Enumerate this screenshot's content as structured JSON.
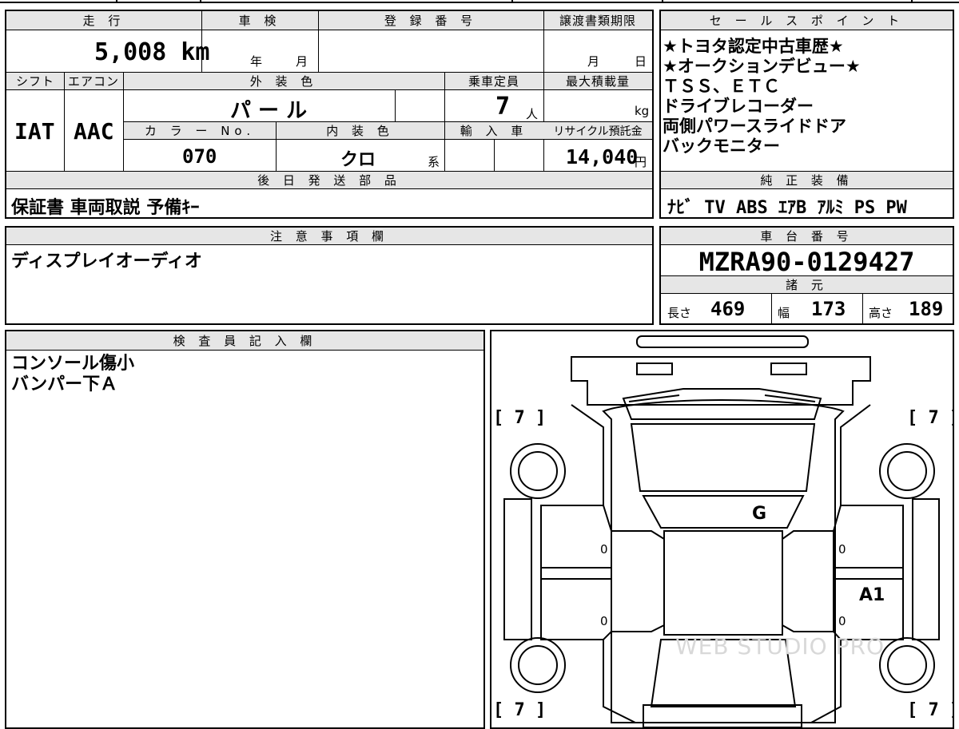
{
  "vehicle": {
    "mileage_label": "走 行",
    "mileage_value": "5,008",
    "mileage_unit": "km",
    "inspection_label": "車 検",
    "inspection_year_unit": "年",
    "inspection_month_unit": "月",
    "registration_label": "登 録 番 号",
    "transfer_label": "譲渡書類期限",
    "transfer_month_unit": "月",
    "transfer_day_unit": "日",
    "shift_label": "シフト",
    "shift_value": "IAT",
    "aircon_label": "エアコン",
    "aircon_value": "AAC",
    "exterior_label": "外 装 色",
    "exterior_value": "パ ー ル",
    "capacity_label": "乗車定員",
    "capacity_value": "7",
    "capacity_unit": "人",
    "max_load_label": "最大積載量",
    "max_load_unit": "kg",
    "color_no_label": "カ ラ ー No.",
    "color_no_value": "070",
    "interior_label": "内 装 色",
    "interior_value": "クロ",
    "interior_suffix": "系",
    "import_label": "輸 入 車",
    "recycle_label": "リサイクル預託金",
    "recycle_value": "14,040",
    "recycle_unit": "円"
  },
  "sales_points": {
    "header": "セ ー ル ス ポ イ ン ト",
    "lines": [
      "★トヨタ認定中古車歴★",
      "★オークションデビュー★",
      "ＴＳＳ、ＥＴＣ",
      "ドライブレコーダー",
      "両側パワースライドドア",
      "バックモニター"
    ]
  },
  "later_parts": {
    "header": "後 日 発 送 部 品",
    "value": "保証書 車両取説 予備ｷｰ"
  },
  "genuine_equipment": {
    "header": "純 正 装 備",
    "value": "ﾅﾋﾞ TV ABS ｴｱB ｱﾙﾐ PS PW"
  },
  "notes": {
    "header": "注 意 事 項 欄",
    "value": "ディスプレイオーディオ"
  },
  "chassis": {
    "header": "車 台 番 号",
    "value": "MZRA90-0129427"
  },
  "specs": {
    "header": "諸 元",
    "length_label": "長さ",
    "length_value": "469",
    "width_label": "幅",
    "width_value": "173",
    "height_label": "高さ",
    "height_value": "189"
  },
  "inspector": {
    "header": "検 査 員 記 入 欄",
    "lines": [
      "コンソール傷小",
      "バンパー下Ａ"
    ]
  },
  "diagram": {
    "tire_fl": "[ 7 ]",
    "tire_fr": "[ 7 ]",
    "tire_rl": "[ 7 ]",
    "tire_rr": "[ 7 ]",
    "mark_windshield": "G",
    "mark_right_rear_door": "A1",
    "mark_left_front_door": "0",
    "mark_left_rear_door": "0",
    "mark_right_front_door": "0",
    "mark_right_rear_door_zero": "0",
    "watermark": "WEB STUDIO PRO"
  }
}
